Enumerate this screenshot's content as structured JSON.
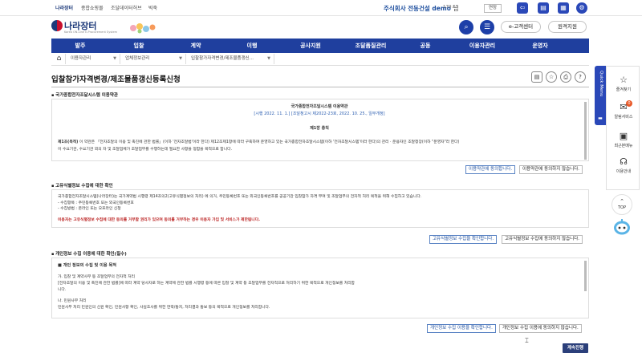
{
  "topbar": {
    "links": [
      "나라장터",
      "종합쇼핑몰",
      "조달데이터허브",
      "빅죽"
    ],
    "company": "주식회사 전동건설 demo",
    "honorific": "님",
    "time": "179:55",
    "extend": "연장"
  },
  "header": {
    "logo_main": "나라장터",
    "logo_sub": "Korea ON-Line E-Procurement System",
    "customer_center": "e-고객센터",
    "remote_support": "원격지원"
  },
  "nav": {
    "items": [
      "발주",
      "입찰",
      "계약",
      "이행",
      "공사지원",
      "조달품질관리",
      "공동",
      "이용자관리",
      "운영자"
    ]
  },
  "breadcrumb": {
    "items": [
      "이용자관리",
      "업체정보관리",
      "입찰참가자격변경/제조물품갱신..."
    ]
  },
  "page": {
    "title": "입찰참가자격변경/제조물품갱신등록신청"
  },
  "section1": {
    "heading": "국가종합전자조달시스템 이용약관",
    "doc_title": "국가종합전자조달시스템 이용약관",
    "doc_date": "[시행 2022. 11. 1.] [조달청고시 제2022-23호, 2022. 10. 25., 일부개정]",
    "chapter": "제1장 총칙",
    "article_label": "제1조(목적)",
    "article_line1": " 이 약관은 「전자조달의 이용 및 촉진에 관한 법률」(이하 '전자조달법'이라 한다) 제12조제1항에 따라 구축하여 운영하고 있는 국가종합전자조달시스템(이하 '전자조달시스템'이라 한다)의 관리 · 운용자인 조달청장(이하 \"운영자\"라 한다)",
    "article_line2": "이 수요기관, 수요기관 외의 자 및 조달업체가 조달업무를 수행하는데 필요한 사항을 정함을 목적으로 합니다.",
    "agree": "이용약관에 동의합니다.",
    "disagree": "이용약관에 동의하지 않습니다."
  },
  "section2": {
    "heading": "고유식별정보 수집에 대한 확인",
    "line1": "국가종합전자조달시스템(나라장터)는 국가계약법 시행령 제14조의2(고유식별정보의 처리) 에 의거, 주민등록번호 또는 외국인등록번호를 공공기관 입찰참가 자격 부여 및 조달업무의 전자적 처리 목적을 위해 수집하고 있습니다.",
    "line2": "- 수집항목 : 주민등록번호 또는 외국인등록번호",
    "line3": "- 수집방법 : 온라인 또는 오프라인 신청",
    "warning": "이용자는 고유식별정보 수집에 대한 동의를 거부할 권리가 있으며 동의를 거부하는 경우 이용자 가입 및 서비스가 제한됩니다.",
    "agree": "고유식별정보 수집을 확인합니다.",
    "disagree": "고유식별정보 수집에 동의하지 않습니다."
  },
  "section3": {
    "heading": "개인정보 수집 이용에 대한 확인(필수)",
    "subhead": "■ 개인 정보의 수집 및 이용 목적",
    "line1": "가. 입찰 및 계약사무 등 조달업무의 전자적 처리",
    "line2": "[전자조달의 이용 및 촉진에 관한 법률]에 따라 계약 당사자로 하는 계약에 관한 법률 시행령 등에 따른 입찰 및 계약 등 조달업무를 전자적으로 처리하기 위한 목적으로 개인정보를 처리합",
    "line3": "니다.",
    "line4": "나. 민원사무 처리",
    "line5": "민원사무 처리 민원인의 신원 확인, 민원사항 확인, 사실조사를 위한 연락/통지, 처리결과 통보 등의 목적으로 개인정보를 처리합니다.",
    "agree": "개인정보 수집 이용을 확인합니다.",
    "disagree": "개인정보 수집 이용에 동의하지 않습니다."
  },
  "proceed": "계속진행",
  "quick_menu": {
    "title": "Quick Menu",
    "items": [
      {
        "icon": "star-icon",
        "label": "즐겨찾기"
      },
      {
        "icon": "notice-icon",
        "label": "알림서비스",
        "badge": "0"
      },
      {
        "icon": "recent-icon",
        "label": "최근본메뉴"
      },
      {
        "icon": "headset-icon",
        "label": "이용안내"
      }
    ],
    "top": "TOP"
  },
  "colors": {
    "brand_blue": "#1f3f9e",
    "accent_blue": "#1d3fa8",
    "warning_red": "#b22222"
  }
}
